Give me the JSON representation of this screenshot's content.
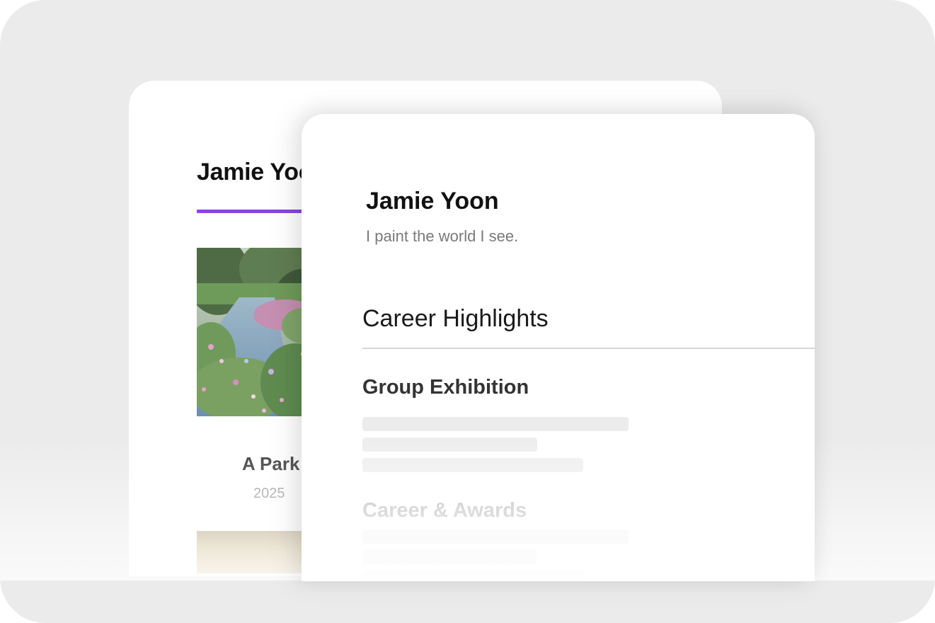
{
  "back_card": {
    "title": "Jamie Yoon",
    "artwork": {
      "title": "A Park",
      "year": "2025"
    },
    "accent_color": "#8b45e0"
  },
  "front_card": {
    "name": "Jamie Yoon",
    "tagline": "I paint the world I see.",
    "section_title": "Career Highlights",
    "sections": [
      {
        "title": "Group Exhibition"
      },
      {
        "title": "Career & Awards"
      }
    ]
  }
}
